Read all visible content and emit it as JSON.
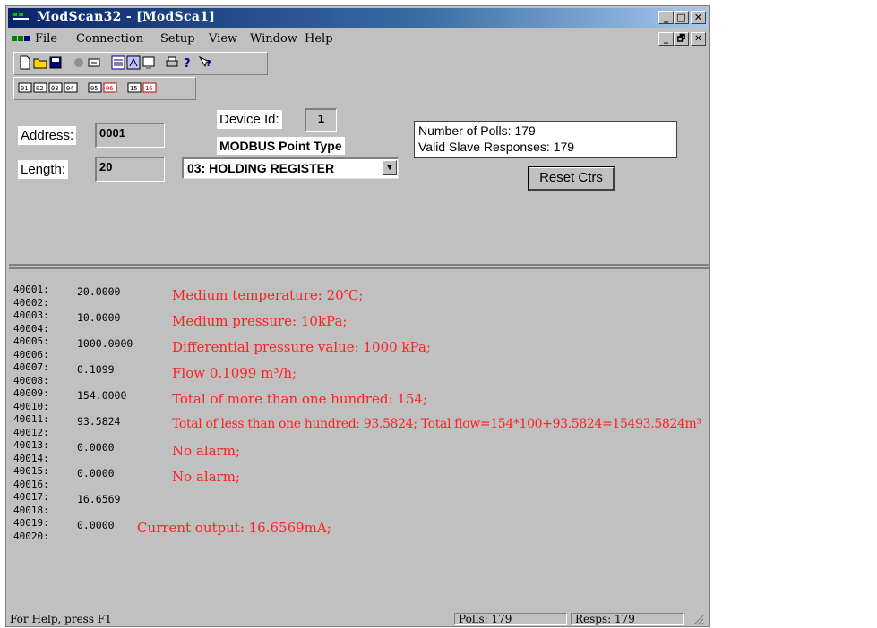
{
  "window": {
    "title": "ModScan32 - [ModSca1]",
    "min_glyph": "_",
    "max_glyph": "□",
    "restore_glyph": "🗗",
    "close_glyph": "✕"
  },
  "menu": {
    "items": [
      "File",
      "Connection",
      "Setup",
      "View",
      "Window",
      "Help"
    ]
  },
  "toolbar": {
    "row1_icons": [
      "new-icon",
      "open-icon",
      "save-icon",
      "connect-icon",
      "disconnect-icon",
      "display-config-icon",
      "display-options-icon",
      "display-hex-icon",
      "print-icon",
      "help-icon",
      "context-help-icon"
    ],
    "row2_icons": [
      "f01-icon",
      "f02-icon",
      "f03-icon",
      "f04-icon",
      "f05-icon",
      "f06-icon",
      "f15-icon",
      "f16-icon"
    ],
    "row2_labels": [
      "01",
      "02",
      "03",
      "04",
      "05",
      "06",
      "15",
      "16"
    ]
  },
  "config": {
    "address_label": "Address:",
    "address_value": "0001",
    "length_label": "Length:",
    "length_value": "20",
    "device_id_label": "Device Id:",
    "device_id_value": "1",
    "point_type_label": "MODBUS Point Type",
    "point_type_value": "03: HOLDING REGISTER",
    "polls_text": "Number of Polls: 179",
    "responses_text": "Valid Slave Responses: 179",
    "reset_label": "Reset Ctrs"
  },
  "registers": [
    {
      "addr": "40001:",
      "value": "20.0000"
    },
    {
      "addr": "40002:",
      "value": ""
    },
    {
      "addr": "40003:",
      "value": "10.0000"
    },
    {
      "addr": "40004:",
      "value": ""
    },
    {
      "addr": "40005:",
      "value": "1000.0000"
    },
    {
      "addr": "40006:",
      "value": ""
    },
    {
      "addr": "40007:",
      "value": "0.1099"
    },
    {
      "addr": "40008:",
      "value": ""
    },
    {
      "addr": "40009:",
      "value": "154.0000"
    },
    {
      "addr": "40010:",
      "value": ""
    },
    {
      "addr": "40011:",
      "value": "93.5824"
    },
    {
      "addr": "40012:",
      "value": ""
    },
    {
      "addr": "40013:",
      "value": "0.0000"
    },
    {
      "addr": "40014:",
      "value": ""
    },
    {
      "addr": "40015:",
      "value": "0.0000"
    },
    {
      "addr": "40016:",
      "value": ""
    },
    {
      "addr": "40017:",
      "value": "16.6569"
    },
    {
      "addr": "40018:",
      "value": ""
    },
    {
      "addr": "40019:",
      "value": "0.0000"
    },
    {
      "addr": "40020:",
      "value": ""
    }
  ],
  "annotations": [
    "Medium temperature: 20℃;",
    "Medium pressure: 10kPa;",
    "Differential pressure value: 1000 kPa;",
    "Flow 0.1099 m³/h;",
    "Total of more than one hundred: 154;",
    "Total of less than one hundred: 93.5824; Total flow=154*100+93.5824=15493.5824m³",
    "No alarm;",
    "No alarm;",
    "Current  output: 16.6569mA;"
  ],
  "status": {
    "help_text": "For Help, press F1",
    "polls": "Polls: 179",
    "resps": "Resps: 179"
  },
  "colors": {
    "annotation": "#ff2020",
    "window_bg": "#c0c0c0"
  }
}
